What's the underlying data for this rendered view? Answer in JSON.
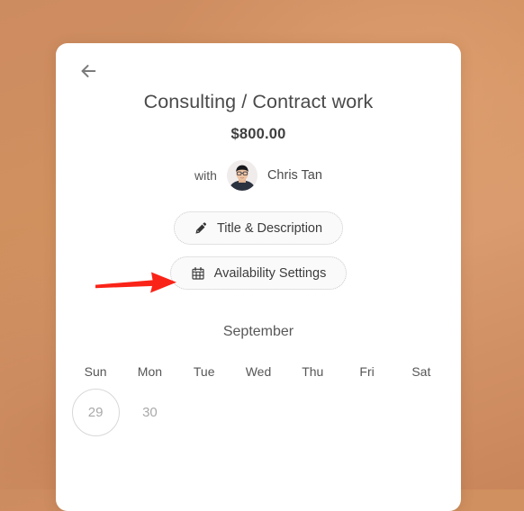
{
  "background": {
    "color_top": "#d1915f",
    "color_bottom": "#c9855a"
  },
  "card": {
    "background": "#ffffff",
    "back_button": {
      "icon": "arrow-left-icon",
      "color": "#7a7a7a"
    },
    "title": "Consulting / Contract work",
    "price": "$800.00",
    "host": {
      "with_label": "with",
      "name": "Chris Tan",
      "avatar": "user-photo-avatar"
    },
    "actions": [
      {
        "icon": "pencil-icon",
        "label": "Title & Description"
      },
      {
        "icon": "calendar-icon",
        "label": "Availability Settings"
      }
    ],
    "calendar": {
      "month": "September",
      "weekdays": [
        "Sun",
        "Mon",
        "Tue",
        "Wed",
        "Thu",
        "Fri",
        "Sat"
      ],
      "days": [
        {
          "label": "29",
          "selected_ring": true,
          "muted": true
        },
        {
          "label": "30",
          "selected_ring": false,
          "muted": true
        },
        {
          "label": "",
          "selected_ring": false,
          "muted": true
        },
        {
          "label": "",
          "selected_ring": false,
          "muted": true
        },
        {
          "label": "",
          "selected_ring": false,
          "muted": true
        },
        {
          "label": "",
          "selected_ring": false,
          "muted": true
        },
        {
          "label": "",
          "selected_ring": false,
          "muted": true
        }
      ]
    }
  },
  "annotation": {
    "arrow_color": "#fa2318",
    "points_to": "Availability Settings"
  }
}
